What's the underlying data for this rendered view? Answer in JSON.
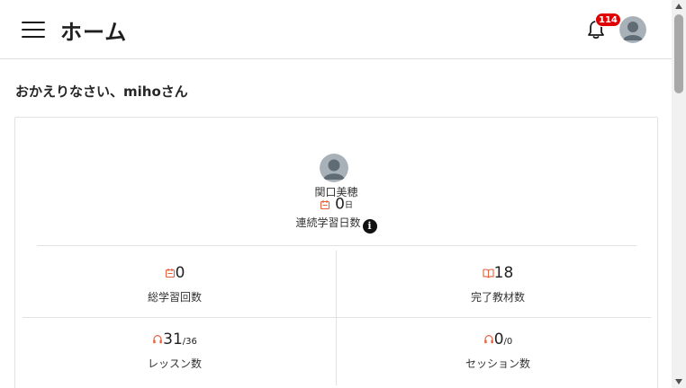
{
  "header": {
    "title": "ホーム",
    "notification_count": "114"
  },
  "welcome": "おかえりなさい、mihoさん",
  "profile": {
    "name": "関口美穂",
    "streak_value": "0",
    "streak_unit": "日",
    "streak_label": "連続学習日数",
    "info_glyph": "i"
  },
  "stats": {
    "total_sessions": {
      "value": "0",
      "label": "総学習回数",
      "icon": "calendar-icon"
    },
    "completed_materials": {
      "value": "18",
      "label": "完了教材数",
      "icon": "book-icon"
    },
    "lessons": {
      "value": "31",
      "sub": "/36",
      "label": "レッスン数",
      "icon": "headset-icon"
    },
    "sessions": {
      "value": "0",
      "sub": "/0",
      "label": "セッション数",
      "icon": "headset-icon"
    }
  },
  "colors": {
    "accent_icon": "#e8603c",
    "badge": "#e00000",
    "text": "#1f1f1f"
  }
}
